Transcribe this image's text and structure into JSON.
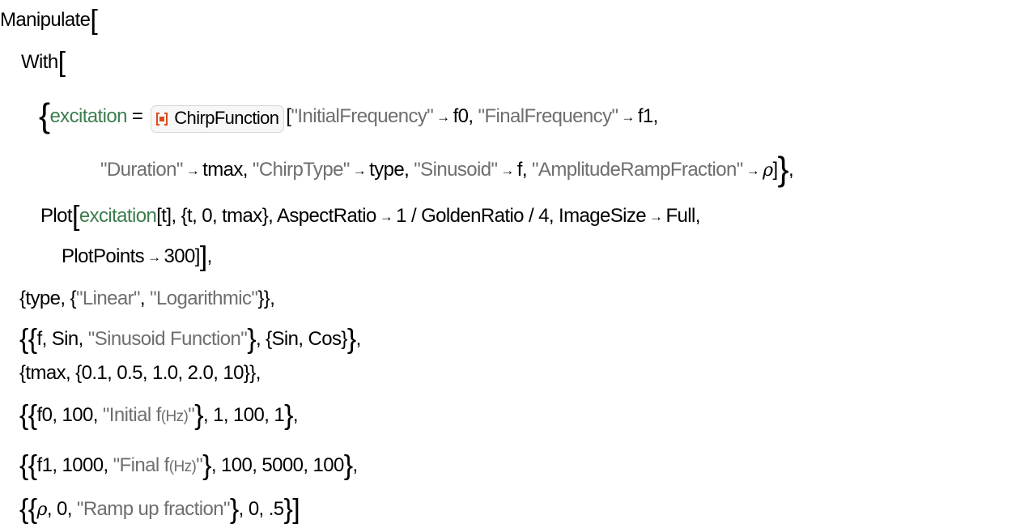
{
  "colors": {
    "symbol": "#000000",
    "local_variable": "#3c7d4f",
    "string": "#6e6e6e",
    "resource_icon": "#dd4b1a"
  },
  "code": {
    "manipulate": "Manipulate",
    "with": "With",
    "excitation": "excitation",
    "equals": "=",
    "resource_function": {
      "icon": "resource-function-icon",
      "label": "ChirpFunction"
    },
    "options": [
      {
        "key": "\"InitialFrequency\"",
        "value": "f0"
      },
      {
        "key": "\"FinalFrequency\"",
        "value": "f1"
      },
      {
        "key": "\"Duration\"",
        "value": "tmax"
      },
      {
        "key": "\"ChirpType\"",
        "value": "type"
      },
      {
        "key": "\"Sinusoid\"",
        "value": "f"
      },
      {
        "key": "\"AmplitudeRampFraction\"",
        "value": "ρ"
      }
    ],
    "arrow": "→",
    "plot": {
      "head": "Plot",
      "fn": "excitation",
      "arg": "[t]",
      "range": "{t, 0, tmax}",
      "aspect_key": "AspectRatio",
      "aspect_val": "1 / GoldenRatio / 4",
      "size_key": "ImageSize",
      "size_val": "Full",
      "points_key": "PlotPoints",
      "points_val": "300"
    },
    "controls": {
      "type": {
        "var": "type",
        "options": [
          "\"Linear\"",
          "\"Logarithmic\""
        ]
      },
      "f": {
        "var": "f",
        "default": "Sin",
        "label": "\"Sinusoid Function\"",
        "options": "{Sin, Cos}"
      },
      "tmax": {
        "var": "tmax",
        "options": "{0.1, 0.5, 1.0, 2.0, 10}"
      },
      "f0": {
        "var": "f0",
        "default": "100",
        "label_a": "\"Initial f",
        "label_b": "(Hz)",
        "label_c": "\"",
        "range": "1, 100, 1"
      },
      "f1": {
        "var": "f1",
        "default": "1000",
        "label_a": "\"Final f",
        "label_b": "(Hz)",
        "label_c": "\"",
        "range": "100, 5000, 100"
      },
      "rho": {
        "var": "ρ",
        "default": "0",
        "label": "\"Ramp up fraction\"",
        "range": "0, .5"
      }
    }
  }
}
